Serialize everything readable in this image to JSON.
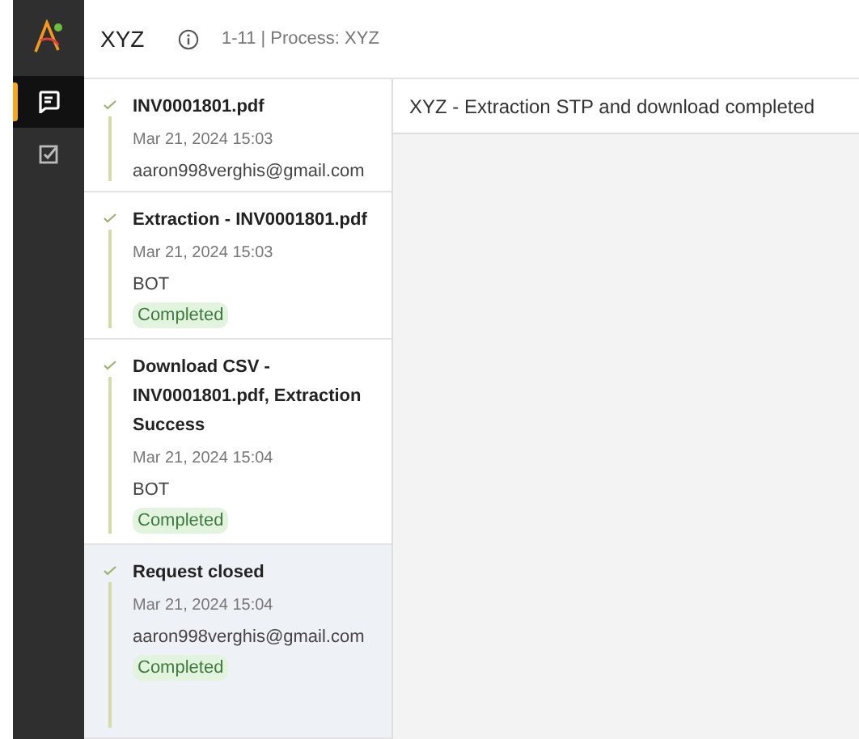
{
  "header": {
    "title": "XYZ",
    "subtitle": "1-11 | Process: XYZ"
  },
  "nav": [
    {
      "kind": "chat",
      "selected": true
    },
    {
      "kind": "tasks",
      "selected": false
    }
  ],
  "timeline": [
    {
      "title": "INV0001801.pdf",
      "time": "Mar 21, 2024 15:03",
      "actor": "aaron998verghis@gmail.com",
      "selected": false
    },
    {
      "title": "Extraction - INV0001801.pdf",
      "time": "Mar 21, 2024 15:03",
      "actor": "BOT",
      "status": "Completed",
      "selected": false
    },
    {
      "title": "Download CSV - INV0001801.pdf, Extraction Success",
      "time": "Mar 21, 2024 15:04",
      "actor": "BOT",
      "status": "Completed",
      "selected": false
    },
    {
      "title": "Request closed",
      "time": "Mar 21, 2024 15:04",
      "actor": "aaron998verghis@gmail.com",
      "status": "Completed",
      "selected": true
    }
  ],
  "detail": {
    "title": "XYZ - Extraction STP and download completed"
  }
}
